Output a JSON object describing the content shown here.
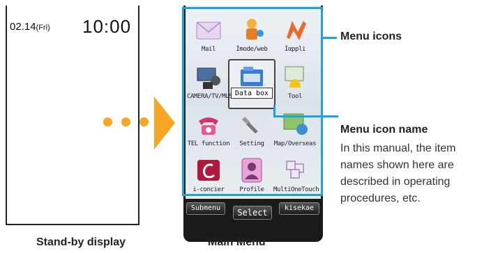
{
  "standby": {
    "date": "02.14",
    "day": "(Fri)",
    "time": "10:00",
    "caption": "Stand-by display"
  },
  "main_menu": {
    "caption": "Main Menu",
    "icons": [
      {
        "label": "Mail"
      },
      {
        "label": "İmode/web"
      },
      {
        "label": "İαppli"
      },
      {
        "label": "CAMERA/TV/MUSIC"
      },
      {
        "label": "Data box"
      },
      {
        "label": "Tool"
      },
      {
        "label": "TEL function"
      },
      {
        "label": "Setting"
      },
      {
        "label": "Map/Overseas"
      },
      {
        "label": "i-concier"
      },
      {
        "label": "Profile"
      },
      {
        "label": "MultiOneTouch"
      }
    ],
    "softkeys": {
      "left": "Submenu",
      "center": "Select",
      "right": "kisekae"
    }
  },
  "callouts": {
    "menu_icons": "Menu icons",
    "icon_name_title": "Menu icon name",
    "icon_name_desc": [
      "In this manual, the item",
      "names shown here are",
      "described in operating",
      "procedures, etc."
    ]
  },
  "colors": {
    "accent_blue": "#1aa3dc",
    "arrow_orange": "#f5a623"
  }
}
